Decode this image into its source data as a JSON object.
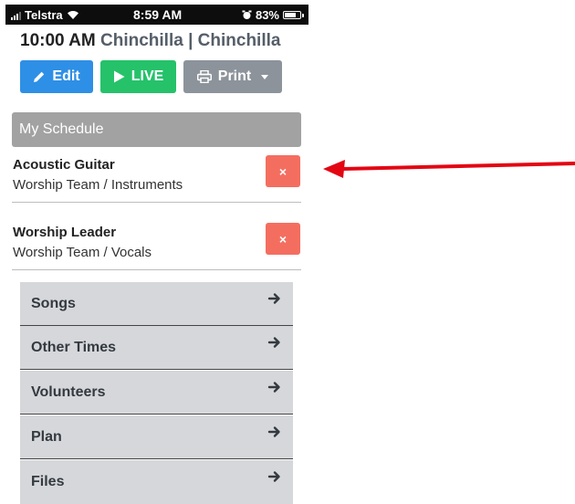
{
  "status_bar": {
    "carrier": "Telstra",
    "time": "8:59 AM",
    "battery": "83%",
    "battery_level": 0.83
  },
  "header": {
    "time": "10:00 AM",
    "location": "Chinchilla | Chinchilla"
  },
  "actions": {
    "edit_label": "Edit",
    "live_label": "LIVE",
    "print_label": "Print"
  },
  "schedule": {
    "title": "My Schedule",
    "items": [
      {
        "role": "Acoustic Guitar",
        "team": "Worship Team / Instruments",
        "remove": "×"
      },
      {
        "role": "Worship Leader",
        "team": "Worship Team / Vocals",
        "remove": "×"
      }
    ]
  },
  "nav": {
    "items": [
      {
        "label": "Songs"
      },
      {
        "label": "Other Times"
      },
      {
        "label": "Volunteers"
      },
      {
        "label": "Plan"
      },
      {
        "label": "Files"
      }
    ]
  },
  "colors": {
    "edit": "#2e8fe6",
    "live": "#25c26a",
    "print": "#8c939b",
    "remove": "#f46e60",
    "annotation_arrow": "#e30613"
  }
}
